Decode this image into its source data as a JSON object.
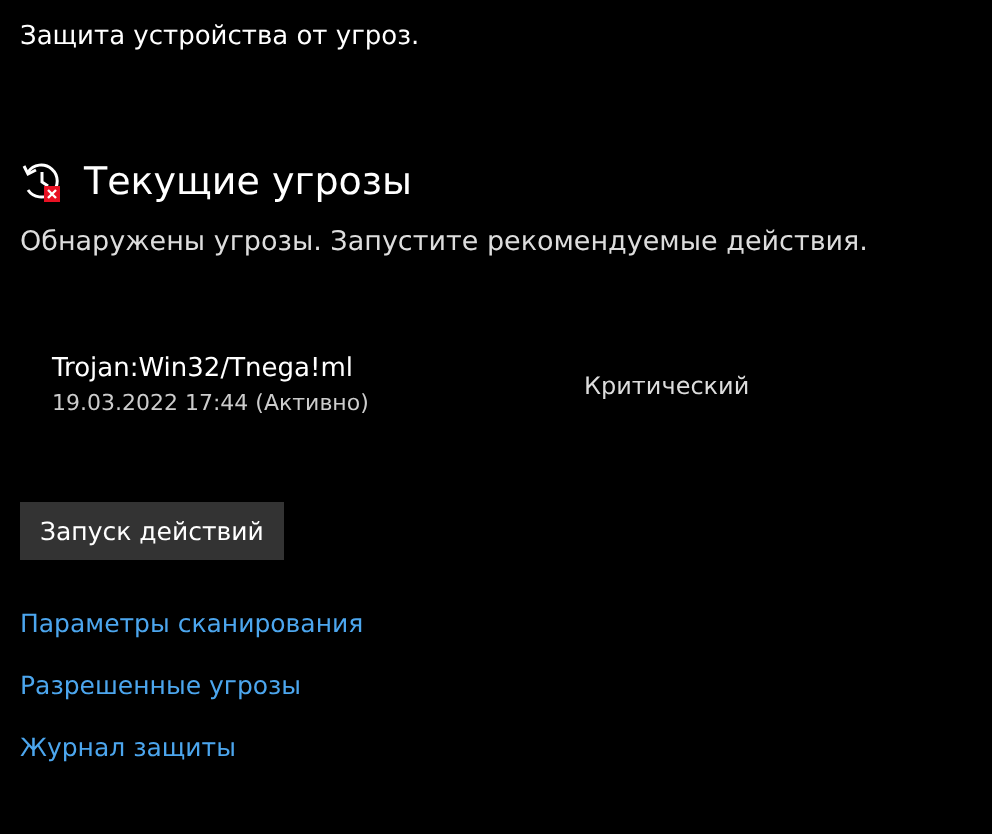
{
  "subtitle": "Защита устройства от угроз.",
  "section": {
    "title": "Текущие угрозы",
    "description": "Обнаружены угрозы. Запустите рекомендуемые действия."
  },
  "threats": [
    {
      "name": "Trojan:Win32/Tnega!ml",
      "date": "19.03.2022 17:44 (Активно)",
      "severity": "Критический"
    }
  ],
  "action_button": "Запуск действий",
  "links": [
    "Параметры сканирования",
    "Разрешенные угрозы",
    "Журнал защиты"
  ]
}
